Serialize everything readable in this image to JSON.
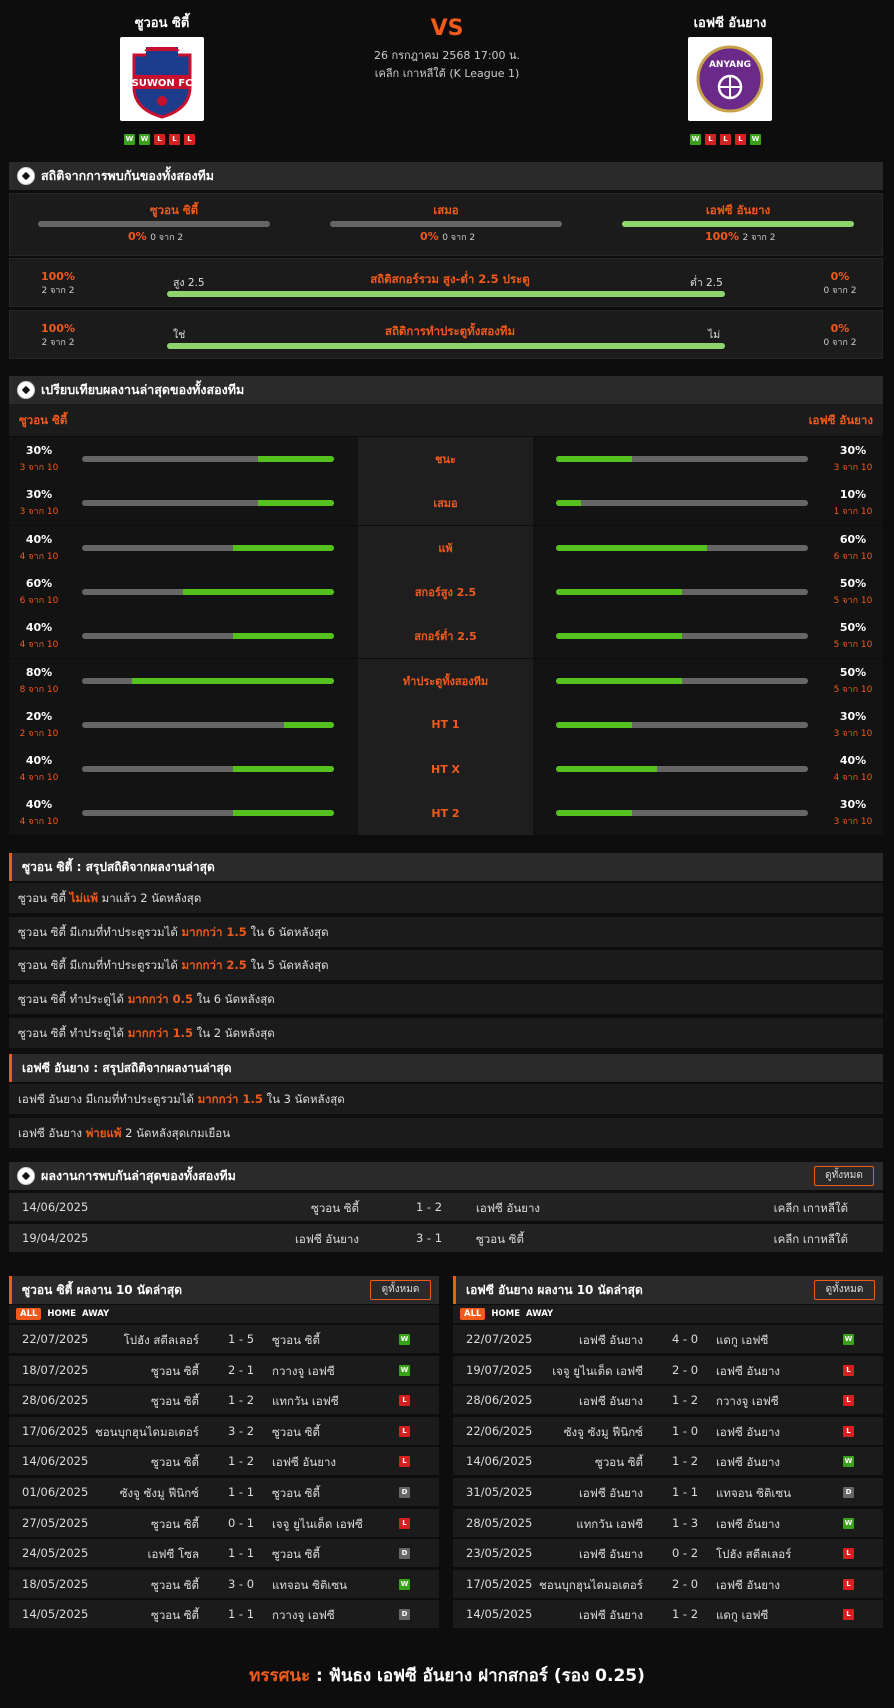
{
  "header": {
    "home_team": "ซูวอน ซิตี้",
    "away_team": "เอฟซี อันยาง",
    "vs": "VS",
    "datetime": "26 กรกฎาคม 2568 17:00 น.",
    "league": "เคลีก เกาหลีใต้ (K League 1)",
    "home_logo_text": "SUWON FC",
    "away_logo_text": "ANYANG",
    "home_form": [
      "W",
      "W",
      "L",
      "L",
      "L"
    ],
    "away_form": [
      "W",
      "L",
      "L",
      "L",
      "W"
    ]
  },
  "h2h_stats": {
    "title": "สถิติจากการพบกันของทั้งสองทีม",
    "home": {
      "label": "ซูวอน ซิตี้",
      "pct": "0%",
      "count": "0 จาก 2",
      "value": 0
    },
    "draw": {
      "label": "เสมอ",
      "pct": "0%",
      "count": "0 จาก 2",
      "value": 0
    },
    "away": {
      "label": "เอฟซี อันยาง",
      "pct": "100%",
      "count": "2 จาก 2",
      "value": 100
    },
    "ou": {
      "title": "สถิติสกอร์รวม สูง-ต่ำ 2.5 ประตู",
      "left_label": "สูง 2.5",
      "right_label": "ต่ำ 2.5",
      "left_pct": "100%",
      "left_count": "2 จาก 2",
      "right_pct": "0%",
      "right_count": "0 จาก 2",
      "value": 100
    },
    "btts": {
      "title": "สถิติการทำประตูทั้งสองทีม",
      "left_label": "ใช่",
      "right_label": "ไม่",
      "left_pct": "100%",
      "left_count": "2 จาก 2",
      "right_pct": "0%",
      "right_count": "0 จาก 2",
      "value": 100
    }
  },
  "compare": {
    "title": "เปรียบเทียบผลงานล่าสุดของทั้งสองทีม",
    "home_label": "ซูวอน ซิตี้",
    "away_label": "เอฟซี อันยาง",
    "rows": [
      {
        "label": "ชนะ",
        "hp": "30%",
        "hc": "3 จาก 10",
        "hv": 30,
        "ap": "30%",
        "ac": "3 จาก 10",
        "av": 30
      },
      {
        "label": "เสมอ",
        "hp": "30%",
        "hc": "3 จาก 10",
        "hv": 30,
        "ap": "10%",
        "ac": "1 จาก 10",
        "av": 10
      },
      {
        "label": "แพ้",
        "hp": "40%",
        "hc": "4 จาก 10",
        "hv": 40,
        "ap": "60%",
        "ac": "6 จาก 10",
        "av": 60
      },
      {
        "label": "สกอร์สูง 2.5",
        "hp": "60%",
        "hc": "6 จาก 10",
        "hv": 60,
        "ap": "50%",
        "ac": "5 จาก 10",
        "av": 50
      },
      {
        "label": "สกอร์ต่ำ 2.5",
        "hp": "40%",
        "hc": "4 จาก 10",
        "hv": 40,
        "ap": "50%",
        "ac": "5 จาก 10",
        "av": 50
      },
      {
        "label": "ทำประตูทั้งสองทีม",
        "hp": "80%",
        "hc": "8 จาก 10",
        "hv": 80,
        "ap": "50%",
        "ac": "5 จาก 10",
        "av": 50
      },
      {
        "label": "HT 1",
        "hp": "20%",
        "hc": "2 จาก 10",
        "hv": 20,
        "ap": "30%",
        "ac": "3 จาก 10",
        "av": 30
      },
      {
        "label": "HT X",
        "hp": "40%",
        "hc": "4 จาก 10",
        "hv": 40,
        "ap": "40%",
        "ac": "4 จาก 10",
        "av": 40
      },
      {
        "label": "HT 2",
        "hp": "40%",
        "hc": "4 จาก 10",
        "hv": 40,
        "ap": "30%",
        "ac": "3 จาก 10",
        "av": 30
      }
    ]
  },
  "home_summary": {
    "title": "ซูวอน ซิตี้ : สรุปสถิติจากผลงานล่าสุด",
    "rows": [
      {
        "a": "ซูวอน ซิตี้ ",
        "b": "ไม่แพ้",
        "c": " มาแล้ว 2 นัดหลังสุด"
      },
      {
        "a": "ซูวอน ซิตี้ มีเกมที่ทำประตูรวมได้ ",
        "b": "มากกว่า 1.5",
        "c": " ใน 6 นัดหลังสุด"
      },
      {
        "a": "ซูวอน ซิตี้ มีเกมที่ทำประตูรวมได้ ",
        "b": "มากกว่า 2.5",
        "c": " ใน 5 นัดหลังสุด"
      },
      {
        "a": "ซูวอน ซิตี้ ทำประตูได้ ",
        "b": "มากกว่า 0.5",
        "c": " ใน 6 นัดหลังสุด"
      },
      {
        "a": "ซูวอน ซิตี้ ทำประตูได้ ",
        "b": "มากกว่า 1.5",
        "c": " ใน 2 นัดหลังสุด"
      }
    ]
  },
  "away_summary": {
    "title": "เอฟซี อันยาง : สรุปสถิติจากผลงานล่าสุด",
    "rows": [
      {
        "a": "เอฟซี อันยาง มีเกมที่ทำประตูรวมได้ ",
        "b": "มากกว่า 1.5",
        "c": " ใน 3 นัดหลังสุด"
      },
      {
        "a": "เอฟซี อันยาง ",
        "b": "พ่ายแพ้",
        "c": " 2 นัดหลังสุดเกมเยือน"
      }
    ]
  },
  "h2h": {
    "title": "ผลงานการพบกันล่าสุดของทั้งสองทีม",
    "view_all": "ดูทั้งหมด",
    "rows": [
      {
        "date": "14/06/2025",
        "home": "ซูวอน ซิตี้",
        "score": "1 - 2",
        "away": "เอฟซี อันยาง",
        "league": "เคลีก เกาหลีใต้"
      },
      {
        "date": "19/04/2025",
        "home": "เอฟซี อันยาง",
        "score": "3 - 1",
        "away": "ซูวอน ซิตี้",
        "league": "เคลีก เกาหลีใต้"
      }
    ]
  },
  "home_last10": {
    "title": "ซูวอน ซิตี้ ผลงาน 10 นัดล่าสุด",
    "view_all": "ดูทั้งหมด",
    "tabs": [
      "ALL",
      "HOME",
      "AWAY"
    ],
    "rows": [
      {
        "date": "22/07/2025",
        "home": "โปฮัง สตีลเลอร์",
        "score": "1 - 5",
        "away": "ซูวอน ซิตี้",
        "r": "W"
      },
      {
        "date": "18/07/2025",
        "home": "ซูวอน ซิตี้",
        "score": "2 - 1",
        "away": "กวางจู เอฟซี",
        "r": "W"
      },
      {
        "date": "28/06/2025",
        "home": "ซูวอน ซิตี้",
        "score": "1 - 2",
        "away": "แทกวัน เอฟซี",
        "r": "L"
      },
      {
        "date": "17/06/2025",
        "home": "ชอนบุกฮุนไดมอเตอร์",
        "score": "3 - 2",
        "away": "ซูวอน ซิตี้",
        "r": "L"
      },
      {
        "date": "14/06/2025",
        "home": "ซูวอน ซิตี้",
        "score": "1 - 2",
        "away": "เอฟซี อันยาง",
        "r": "L"
      },
      {
        "date": "01/06/2025",
        "home": "ซังจู ซังมู ฟีนิกซ์",
        "score": "1 - 1",
        "away": "ซูวอน ซิตี้",
        "r": "D"
      },
      {
        "date": "27/05/2025",
        "home": "ซูวอน ซิตี้",
        "score": "0 - 1",
        "away": "เจจู ยูไนเต็ด เอฟซี",
        "r": "L"
      },
      {
        "date": "24/05/2025",
        "home": "เอฟซี โซล",
        "score": "1 - 1",
        "away": "ซูวอน ซิตี้",
        "r": "D"
      },
      {
        "date": "18/05/2025",
        "home": "ซูวอน ซิตี้",
        "score": "3 - 0",
        "away": "แทจอน ซิติเซน",
        "r": "W"
      },
      {
        "date": "14/05/2025",
        "home": "ซูวอน ซิตี้",
        "score": "1 - 1",
        "away": "กวางจู เอฟซี",
        "r": "D"
      }
    ]
  },
  "away_last10": {
    "title": "เอฟซี อันยาง ผลงาน 10 นัดล่าสุด",
    "view_all": "ดูทั้งหมด",
    "tabs": [
      "ALL",
      "HOME",
      "AWAY"
    ],
    "rows": [
      {
        "date": "22/07/2025",
        "home": "เอฟซี อันยาง",
        "score": "4 - 0",
        "away": "แดกู เอฟซี",
        "r": "W"
      },
      {
        "date": "19/07/2025",
        "home": "เจจู ยูไนเต็ด เอฟซี",
        "score": "2 - 0",
        "away": "เอฟซี อันยาง",
        "r": "L"
      },
      {
        "date": "28/06/2025",
        "home": "เอฟซี อันยาง",
        "score": "1 - 2",
        "away": "กวางจู เอฟซี",
        "r": "L"
      },
      {
        "date": "22/06/2025",
        "home": "ซังจู ซังมู ฟีนิกซ์",
        "score": "1 - 0",
        "away": "เอฟซี อันยาง",
        "r": "L"
      },
      {
        "date": "14/06/2025",
        "home": "ซูวอน ซิตี้",
        "score": "1 - 2",
        "away": "เอฟซี อันยาง",
        "r": "W"
      },
      {
        "date": "31/05/2025",
        "home": "เอฟซี อันยาง",
        "score": "1 - 1",
        "away": "แทจอน ซิติเซน",
        "r": "D"
      },
      {
        "date": "28/05/2025",
        "home": "แทกวัน เอฟซี",
        "score": "1 - 3",
        "away": "เอฟซี อันยาง",
        "r": "W"
      },
      {
        "date": "23/05/2025",
        "home": "เอฟซี อันยาง",
        "score": "0 - 2",
        "away": "โปฮัง สตีลเลอร์",
        "r": "L"
      },
      {
        "date": "17/05/2025",
        "home": "ชอนบุกฮุนไดมอเตอร์",
        "score": "2 - 0",
        "away": "เอฟซี อันยาง",
        "r": "L"
      },
      {
        "date": "14/05/2025",
        "home": "เอฟซี อันยาง",
        "score": "1 - 2",
        "away": "แดกู เอฟซี",
        "r": "L"
      }
    ]
  },
  "prediction": {
    "label": "ทรรศนะ",
    "sep": " : ",
    "text": "ฟันธง เอฟซี อันยาง ฝากสกอร์ (รอง 0.25)"
  },
  "colors": {
    "accent": "#f05a1a",
    "green": "#55c11c",
    "win": "#3aa11a",
    "loss": "#d42020",
    "draw": "#666666"
  }
}
